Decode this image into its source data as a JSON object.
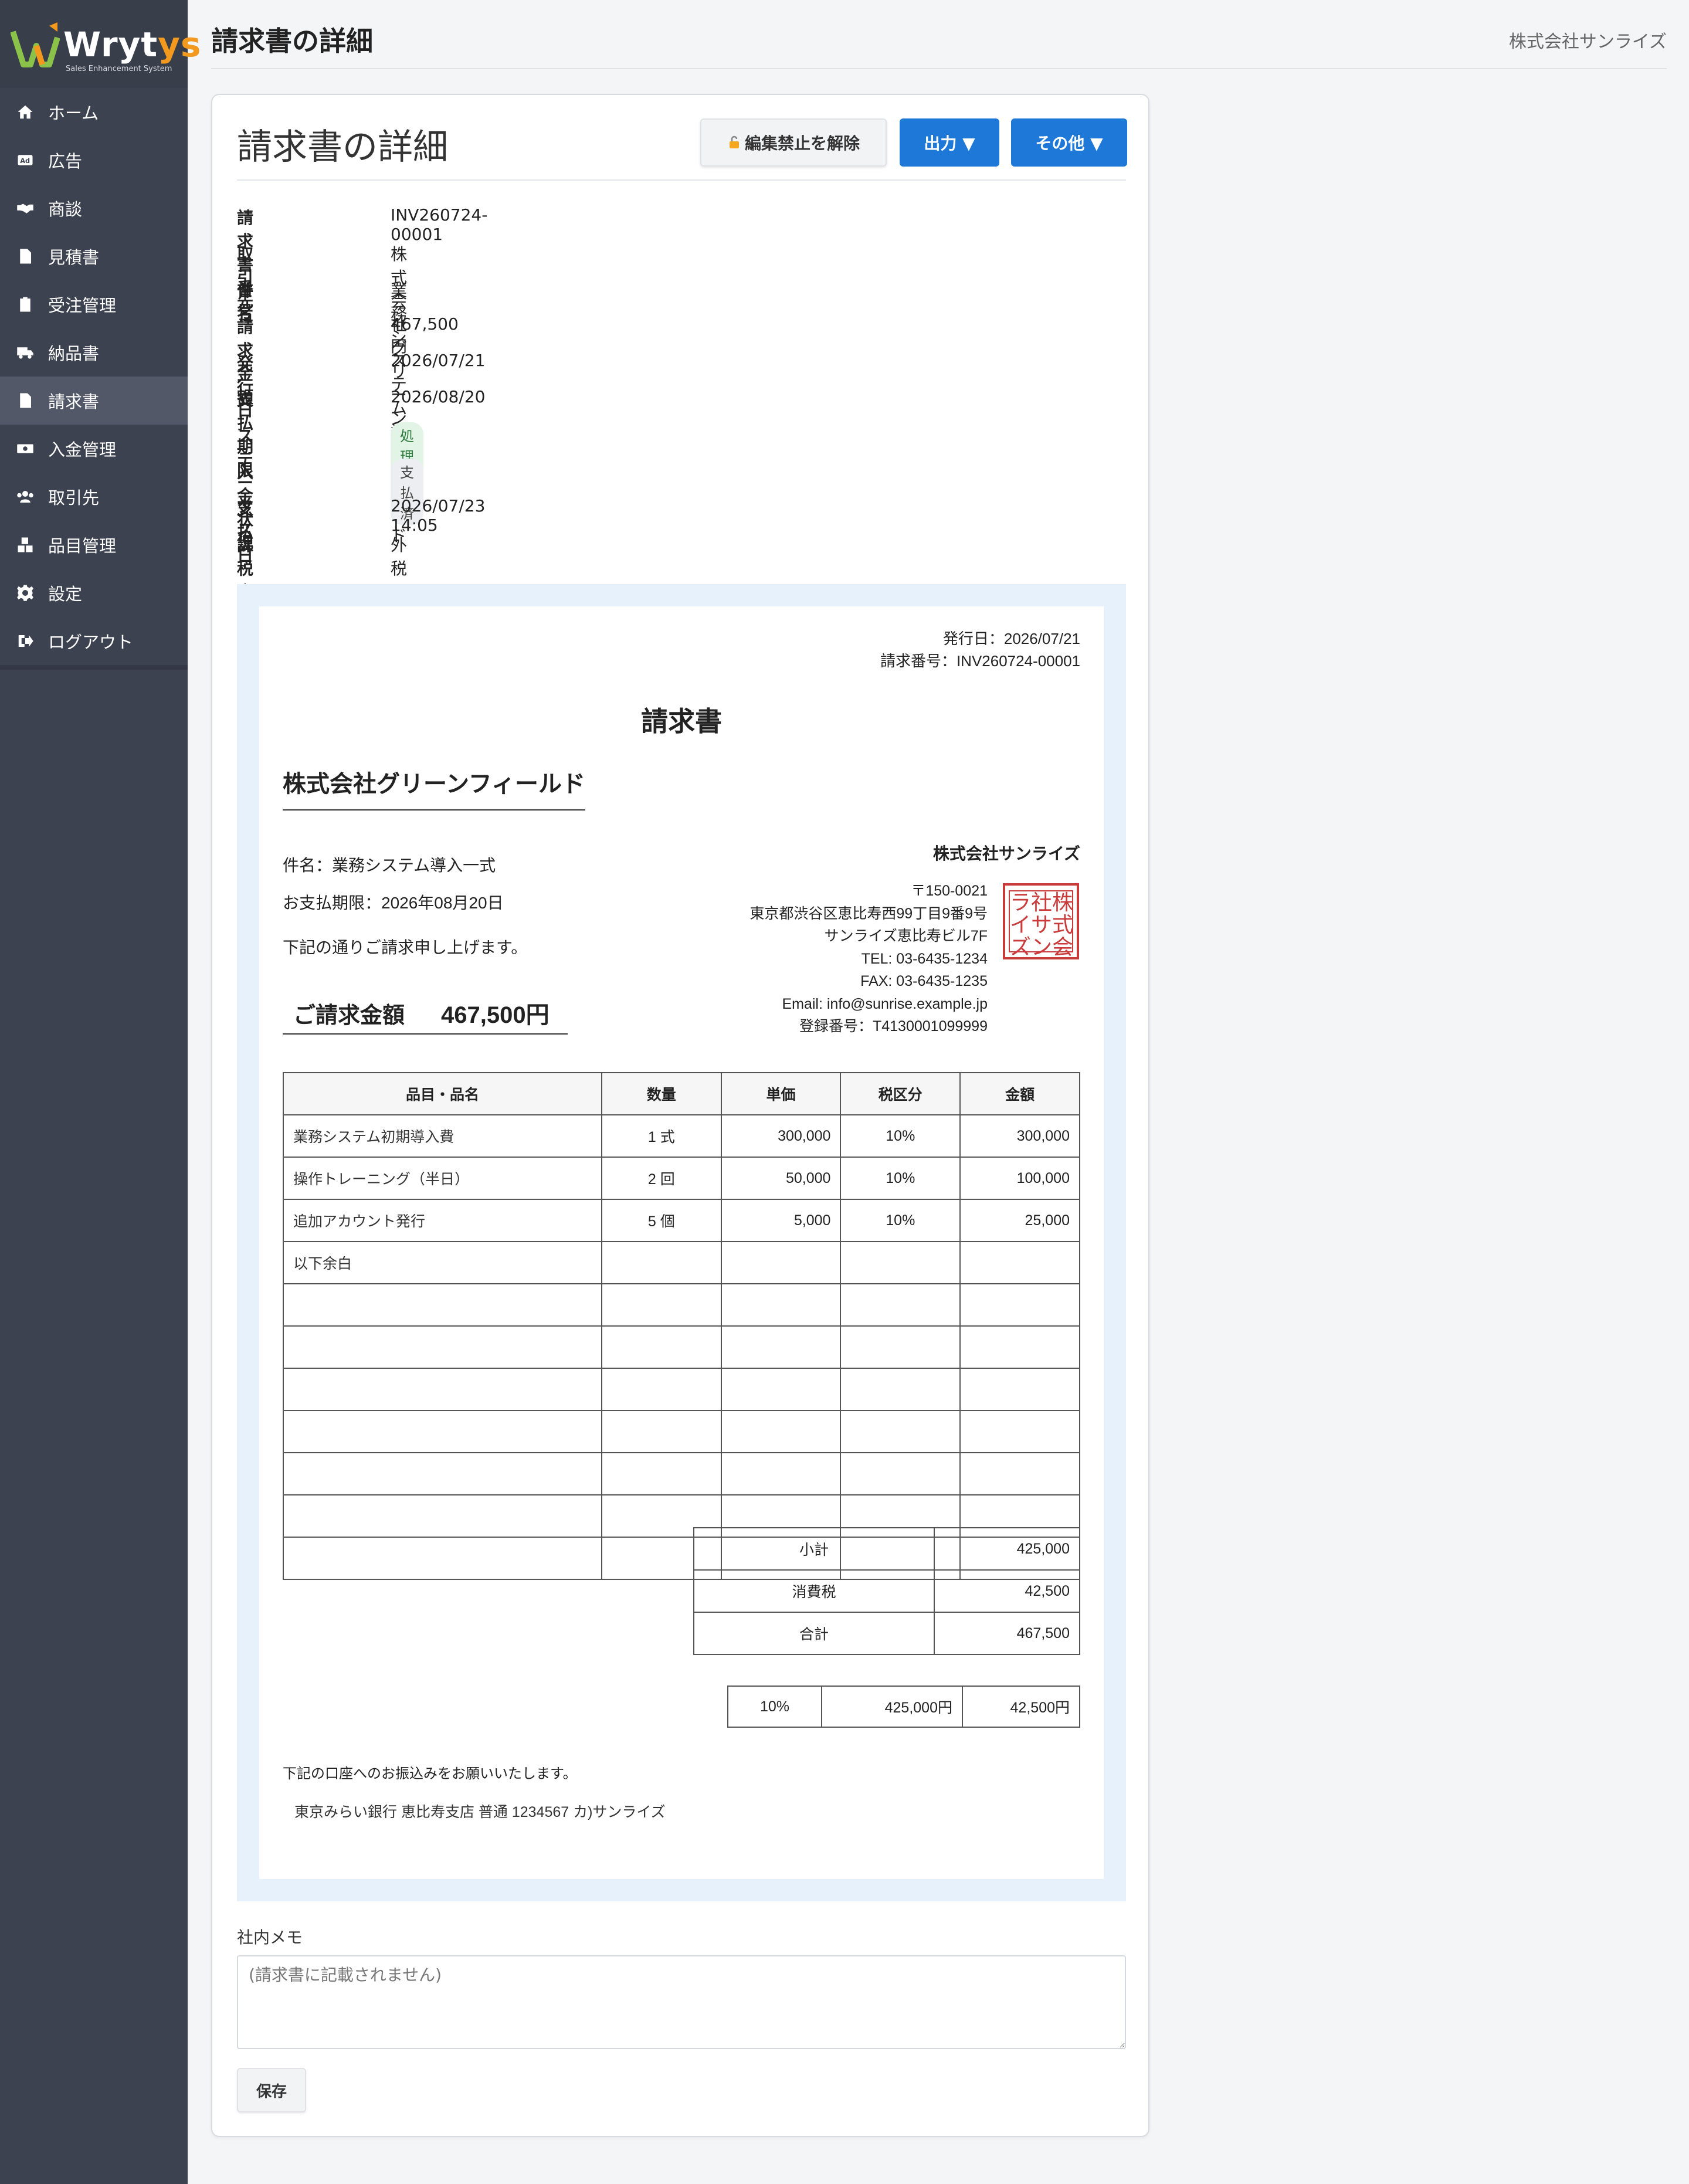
{
  "brand": {
    "logo_main": "Wryt",
    "logo_accent": "ys",
    "tagline": "Sales Enhancement System",
    "accent_color": "#f39a1e"
  },
  "sidebar": {
    "items": [
      {
        "label": "ホーム",
        "icon": "home-icon"
      },
      {
        "label": "広告",
        "icon": "ad-icon"
      },
      {
        "label": "商談",
        "icon": "handshake-icon"
      },
      {
        "label": "見積書",
        "icon": "document-icon"
      },
      {
        "label": "受注管理",
        "icon": "clipboard-check-icon"
      },
      {
        "label": "納品書",
        "icon": "truck-icon"
      },
      {
        "label": "請求書",
        "icon": "invoice-icon"
      },
      {
        "label": "入金管理",
        "icon": "money-icon"
      },
      {
        "label": "取引先",
        "icon": "users-icon"
      },
      {
        "label": "品目管理",
        "icon": "boxes-icon"
      },
      {
        "label": "設定",
        "icon": "gear-icon"
      },
      {
        "label": "ログアウト",
        "icon": "logout-icon"
      }
    ],
    "active_index": 6
  },
  "header": {
    "title": "請求書の詳細",
    "company": "株式会社サンライズ"
  },
  "card": {
    "title": "請求書の詳細",
    "buttons": {
      "unlock": "編集禁止を解除",
      "export": "出力 ▼",
      "other": "その他 ▼"
    },
    "fields": [
      {
        "label": "請求書番号",
        "value": "INV260724-00001"
      },
      {
        "label": "取引先",
        "value": "株式会社グリーンフィールド"
      },
      {
        "label": "件名",
        "value": "業務システム導入一式"
      },
      {
        "label": "請求金額",
        "value": "467,500円"
      },
      {
        "label": "発行日",
        "value": "2026/07/21"
      },
      {
        "label": "支払期限",
        "value": "2026/08/20"
      },
      {
        "label": "ステータス",
        "value": "処理済"
      },
      {
        "label": "入金状況",
        "value": "支払済"
      },
      {
        "label": "支払日",
        "value": "2026/07/23 14:05"
      },
      {
        "label": "課税方式",
        "value": "外税"
      }
    ]
  },
  "invoice": {
    "issue_date": "発行日：2026/07/21",
    "invoice_no": "請求番号：INV260724-00001",
    "title": "請求書",
    "client": "株式会社グリーンフィールド",
    "subject": "件名：業務システム導入一式",
    "due": "お支払期限：2026年08月20日",
    "request_text": "下記の通りご請求申し上げます。",
    "total_label": "ご請求金額",
    "total_amount": "467,500円",
    "issuer": {
      "name": "株式会社サンライズ",
      "postal": "〒150-0021",
      "address1": "東京都渋谷区恵比寿西99丁目9番9号",
      "address2": "サンライズ恵比寿ビル7F",
      "tel": "TEL: 03-6435-1234",
      "fax": "FAX: 03-6435-1235",
      "email": "Email: info@sunrise.example.jp",
      "reg": "登録番号：T4130001099999",
      "seal_chars": [
        "ラ",
        "社",
        "株",
        "イ",
        "サ",
        "式",
        "ズ",
        "ン",
        "会"
      ]
    },
    "table_headers": [
      "品目・品名",
      "数量",
      "単価",
      "税区分",
      "金額"
    ],
    "rows": [
      [
        "業務システム初期導入費",
        "1 式",
        "300,000",
        "10%",
        "300,000"
      ],
      [
        "操作トレーニング（半日）",
        "2 回",
        "50,000",
        "10%",
        "100,000"
      ],
      [
        "追加アカウント発行",
        "5 個",
        "5,000",
        "10%",
        "25,000"
      ],
      [
        "以下余白",
        "",
        "",
        "",
        ""
      ],
      [
        "",
        "",
        "",
        "",
        ""
      ],
      [
        "",
        "",
        "",
        "",
        ""
      ],
      [
        "",
        "",
        "",
        "",
        ""
      ],
      [
        "",
        "",
        "",
        "",
        ""
      ],
      [
        "",
        "",
        "",
        "",
        ""
      ],
      [
        "",
        "",
        "",
        "",
        ""
      ],
      [
        "",
        "",
        "",
        "",
        ""
      ]
    ],
    "sums": [
      {
        "label": "小計",
        "value": "425,000"
      },
      {
        "label": "消費税",
        "value": "42,500"
      },
      {
        "label": "合計",
        "value": "467,500"
      }
    ],
    "tax_breakdown": [
      "10%",
      "425,000円",
      "42,500円"
    ],
    "bank_note": "下記の口座へのお振込みをお願いいたします。",
    "bank": "東京みらい銀行 恵比寿支店 普通 1234567 カ)サンライズ"
  },
  "memo": {
    "label": "社内メモ",
    "placeholder": "(請求書に記載されません)"
  },
  "save_label": "保存"
}
